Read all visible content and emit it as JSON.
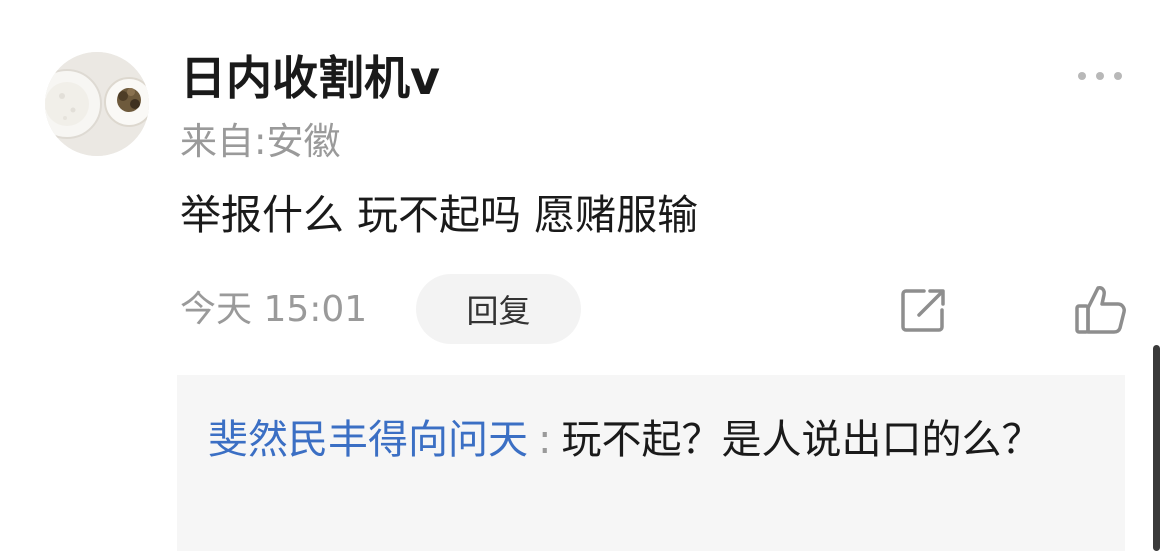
{
  "comment": {
    "username": "日内收割机v",
    "location": "来自:安徽",
    "content": "举报什么 玩不起吗 愿赌服输",
    "timestamp": "今天 15:01",
    "reply_label": "回复",
    "icons": {
      "more": "more-dots-icon",
      "share": "share-icon",
      "like": "thumbs-up-icon"
    }
  },
  "reply": {
    "author": "斐然民丰得向问天",
    "separator": ":",
    "text": "玩不起？是人说出口的么？"
  },
  "colors": {
    "link_blue": "#3b6fc4",
    "muted_gray": "#9a9a9a",
    "reply_bg": "#f6f6f6",
    "button_bg": "#f3f3f3"
  }
}
